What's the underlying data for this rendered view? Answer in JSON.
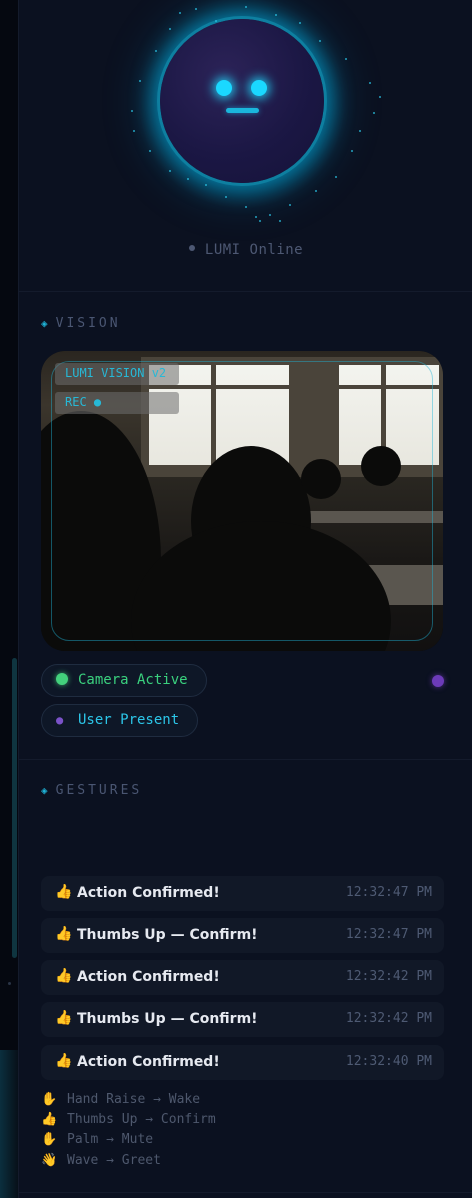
{
  "avatar": {
    "status": "LUMI Online"
  },
  "vision": {
    "section_title": "VISION",
    "overlay_title": "LUMI VISION v2",
    "rec_label": "REC ●",
    "camera_status": "Camera Active",
    "user_status": "User Present"
  },
  "gestures": {
    "section_title": "GESTURES",
    "log": [
      {
        "icon": "👍",
        "text": "Action Confirmed!",
        "time": "12:32:47 PM"
      },
      {
        "icon": "👍",
        "text": "Thumbs Up — Confirm!",
        "time": "12:32:47 PM"
      },
      {
        "icon": "👍",
        "text": "Action Confirmed!",
        "time": "12:32:42 PM"
      },
      {
        "icon": "👍",
        "text": "Thumbs Up — Confirm!",
        "time": "12:32:42 PM"
      },
      {
        "icon": "👍",
        "text": "Action Confirmed!",
        "time": "12:32:40 PM"
      }
    ],
    "legend": [
      {
        "icon": "✋",
        "text": "Hand Raise → Wake"
      },
      {
        "icon": "👍",
        "text": "Thumbs Up → Confirm"
      },
      {
        "icon": "✋",
        "text": "Palm → Mute"
      },
      {
        "icon": "👋",
        "text": "Wave → Greet"
      }
    ]
  },
  "colors": {
    "accent": "#1ad8ff",
    "success": "#3ad07e",
    "purple": "#6c3bb8",
    "background": "#0b1120"
  }
}
